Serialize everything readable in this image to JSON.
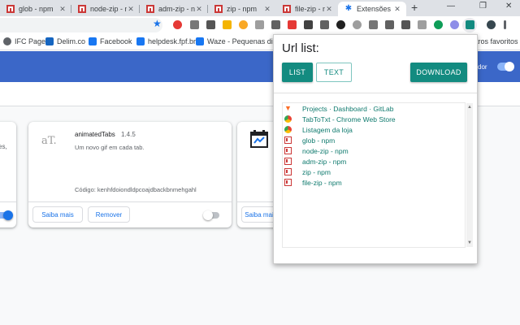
{
  "tabs": [
    {
      "title": "glob - npm",
      "icon": "npm-icon"
    },
    {
      "title": "node-zip - n",
      "icon": "npm-icon"
    },
    {
      "title": "adm-zip - n",
      "icon": "npm-icon"
    },
    {
      "title": "zip - npm",
      "icon": "npm-icon"
    },
    {
      "title": "file-zip - npm",
      "icon": "npm-icon"
    },
    {
      "title": "Extensões",
      "icon": "puzzle-icon",
      "active": true
    }
  ],
  "new_tab_label": "+",
  "window_controls": {
    "minimize": "—",
    "maximize": "❐",
    "close": "✕"
  },
  "bookmarks": [
    {
      "label": "IFC Page",
      "color": "#5f6368"
    },
    {
      "label": "Delim.co",
      "color": "#1565c0"
    },
    {
      "label": "Facebook",
      "color": "#1877f2"
    },
    {
      "label": "helpdesk.fpf.br",
      "color": "#1877f2"
    },
    {
      "label": "Waze - Pequenas di...",
      "color": "#1877f2"
    }
  ],
  "bookmarks_overflow": "tros favoritos",
  "header": {
    "dev_mode_label": "dor"
  },
  "cards": [
    {
      "description": "es,",
      "toggle_on": true
    },
    {
      "logo_text": "aT.",
      "name": "animatedTabs",
      "version": "1.4.5",
      "description": "Um novo gif em cada tab.",
      "id_label": "Código: kenhfdoiondldpcoajdbackbnmehgahl",
      "details_label": "Saiba mais",
      "remove_label": "Remover",
      "toggle_on": false
    },
    {
      "details_label": "Saiba mais"
    }
  ],
  "popup": {
    "title": "Url list:",
    "list_label": "LIST",
    "text_label": "TEXT",
    "download_label": "DOWNLOAD",
    "urls": [
      {
        "text": "Projects · Dashboard · GitLab",
        "icon": "gitlab-icon"
      },
      {
        "text": "TabToTxt - Chrome Web Store",
        "icon": "webstore-icon"
      },
      {
        "text": "Listagem da loja",
        "icon": "webstore-icon"
      },
      {
        "text": "glob - npm",
        "icon": "npm-icon"
      },
      {
        "text": "node-zip - npm",
        "icon": "npm-icon"
      },
      {
        "text": "adm-zip - npm",
        "icon": "npm-icon"
      },
      {
        "text": "zip - npm",
        "icon": "npm-icon"
      },
      {
        "text": "file-zip - npm",
        "icon": "npm-icon"
      }
    ]
  },
  "colors": {
    "accent": "#138b80",
    "header_blue": "#3b67c8",
    "npm_red": "#cb3837"
  }
}
